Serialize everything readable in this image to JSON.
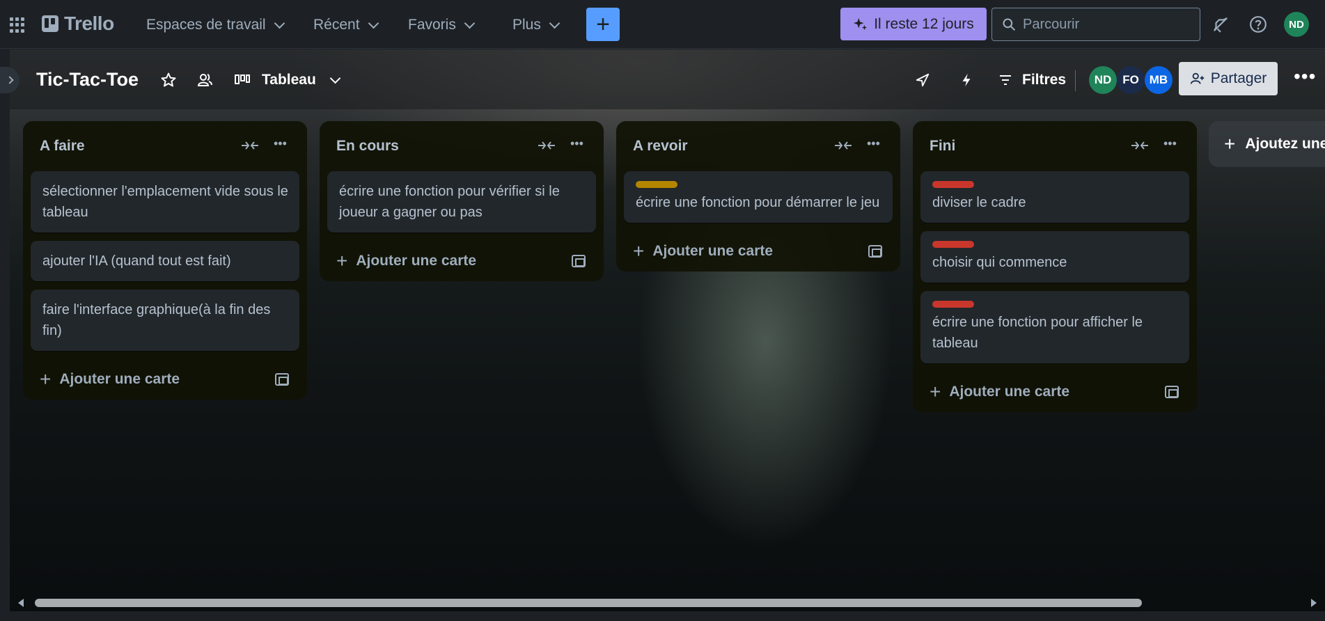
{
  "app": {
    "name": "Trello"
  },
  "nav": {
    "menus": [
      "Espaces de travail",
      "Récent",
      "Favoris",
      "Plus"
    ],
    "create_label": "+",
    "trial_label": "Il reste 12 jours",
    "search_placeholder": "Parcourir",
    "user_initials": "ND",
    "user_color": "#1f845a"
  },
  "board": {
    "title": "Tic-Tac-Toe",
    "view_label": "Tableau",
    "filters_label": "Filtres",
    "share_label": "Partager",
    "members": [
      {
        "initials": "ND",
        "color": "#1f845a"
      },
      {
        "initials": "FO",
        "color": "#1c2b4a"
      },
      {
        "initials": "MB",
        "color": "#0c66e4"
      }
    ],
    "add_list_label": "Ajoutez une"
  },
  "lists": [
    {
      "title": "A faire",
      "cards": [
        {
          "text": "sélectionner l'emplacement vide sous le tableau",
          "label_color": null
        },
        {
          "text": "ajouter l'IA (quand tout est fait)",
          "label_color": null
        },
        {
          "text": "faire l'interface graphique(à la fin des fin)",
          "label_color": null
        }
      ],
      "add_card_label": "Ajouter une carte"
    },
    {
      "title": "En cours",
      "cards": [
        {
          "text": "écrire une fonction pour vérifier si le joueur a gagner ou pas",
          "label_color": null
        }
      ],
      "add_card_label": "Ajouter une carte"
    },
    {
      "title": "A revoir",
      "cards": [
        {
          "text": "écrire une fonction pour démarrer le jeu",
          "label_color": "#b38600"
        }
      ],
      "add_card_label": "Ajouter une carte"
    },
    {
      "title": "Fini",
      "cards": [
        {
          "text": "diviser le cadre",
          "label_color": "#c9372c"
        },
        {
          "text": "choisir qui commence",
          "label_color": "#c9372c"
        },
        {
          "text": "écrire une fonction pour afficher le tableau",
          "label_color": "#c9372c"
        }
      ],
      "add_card_label": "Ajouter une carte"
    }
  ]
}
